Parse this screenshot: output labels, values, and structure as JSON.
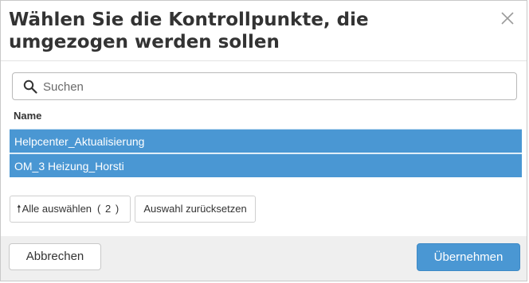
{
  "dialog": {
    "title": "Wählen Sie die Kontrollpunkte, die umgezogen werden sollen",
    "close_icon": "close-icon"
  },
  "search": {
    "placeholder": "Suchen",
    "value": "",
    "icon": "search-icon"
  },
  "list": {
    "column_header": "Name",
    "rows": [
      {
        "label": "Helpcenter_Aktualisierung",
        "selected": true
      },
      {
        "label": "OM_3 Heizung_Horsti",
        "selected": true
      }
    ]
  },
  "selection": {
    "select_all_label": "Alle auswählen",
    "select_all_icon": "arrow-up-icon",
    "count": "( 2 )",
    "reset_label": "Auswahl zurücksetzen"
  },
  "footer": {
    "cancel_label": "Abbrechen",
    "confirm_label": "Übernehmen"
  },
  "colors": {
    "accent": "#4a97d3",
    "footer_bg": "#efefef"
  }
}
